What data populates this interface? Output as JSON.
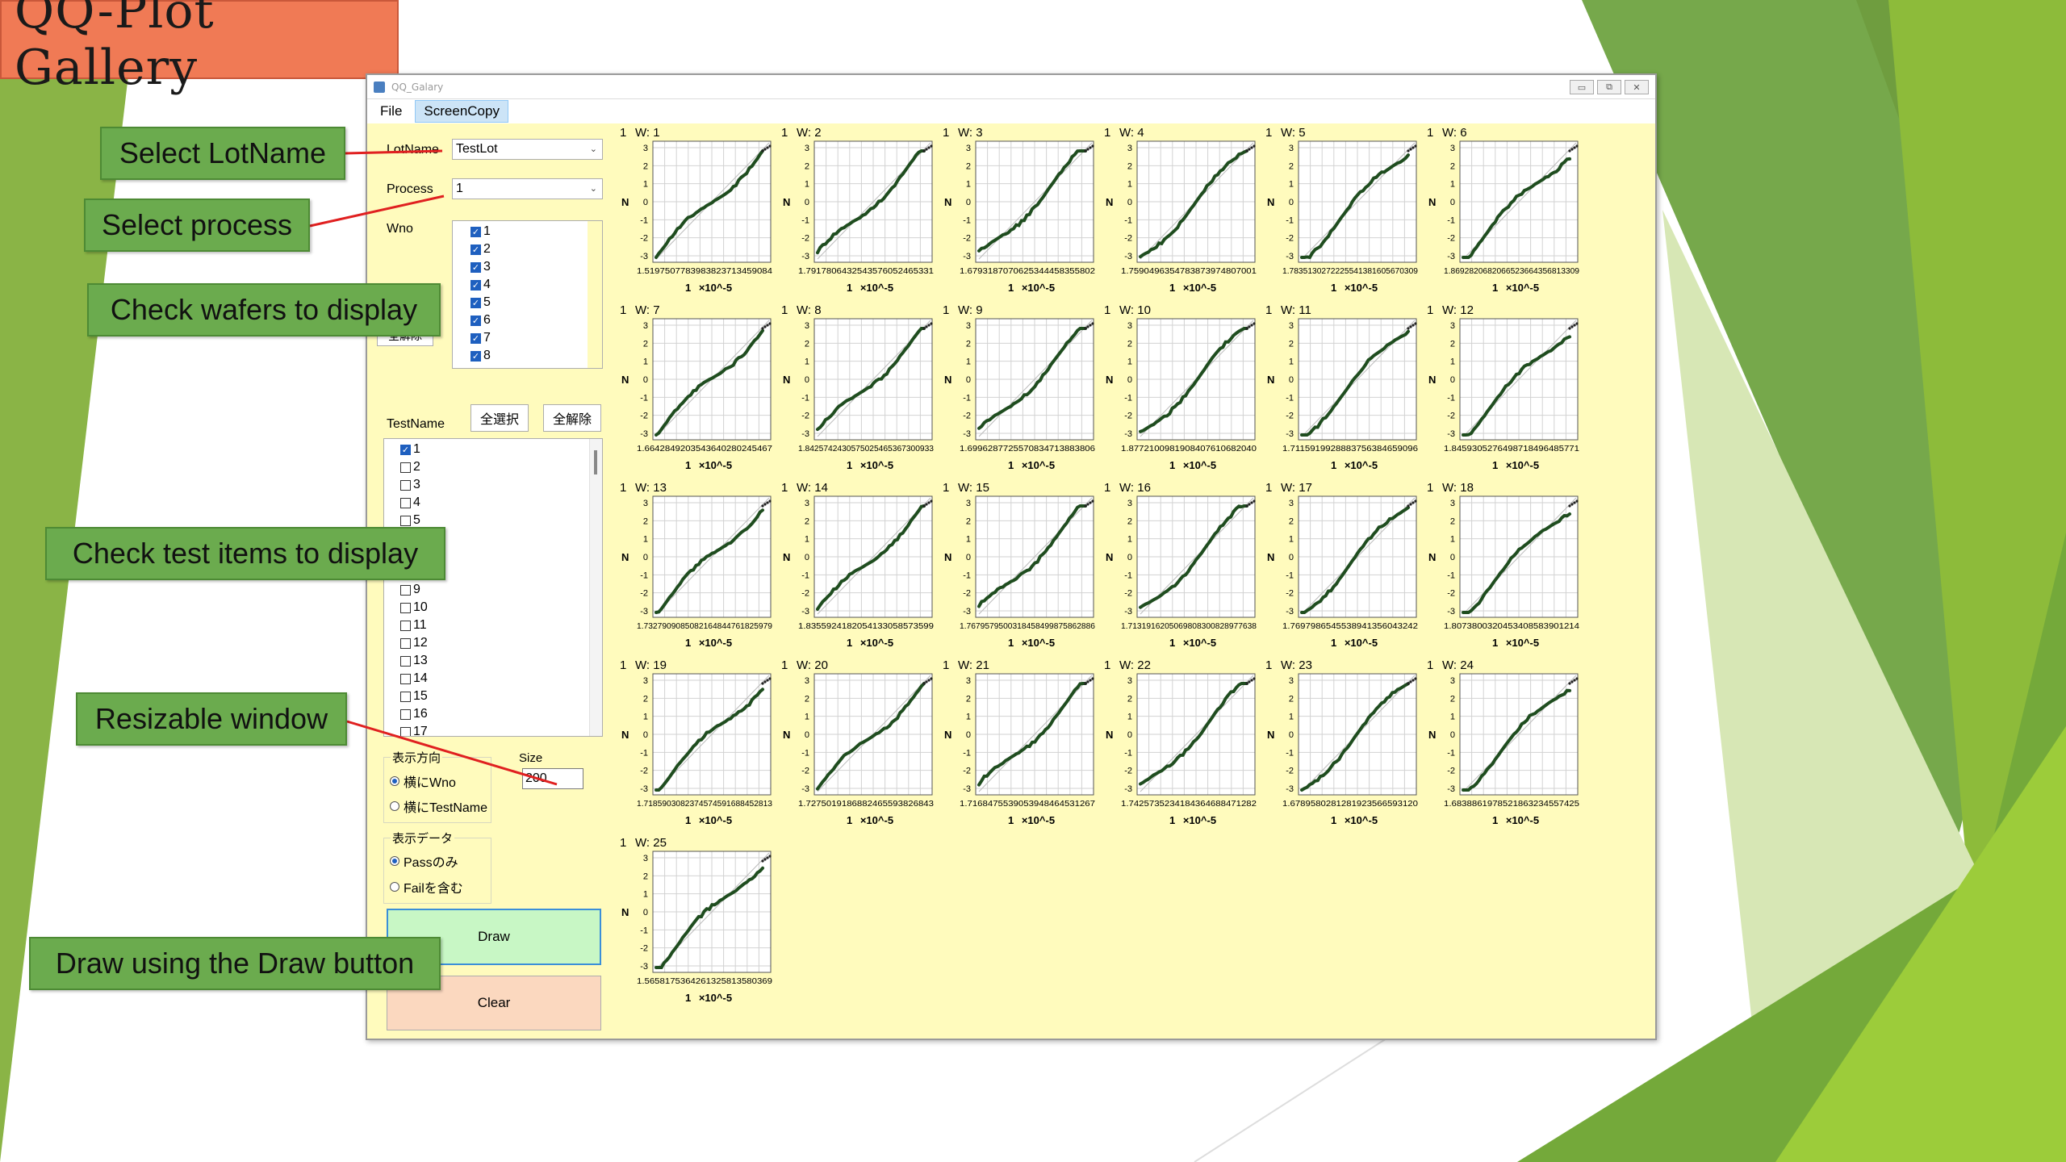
{
  "slide": {
    "title": "QQ-Plot Gallery",
    "callouts": {
      "lotname": "Select LotName",
      "process": "Select process",
      "wafers": "Check wafers to display",
      "tests": "Check test items to display",
      "resize": "Resizable window",
      "draw": "Draw using the Draw button"
    },
    "colors": {
      "title_bg": "#f07a55",
      "callout_bg": "#6bab4e",
      "plot_line": "#1f4d1f",
      "window_bg": "#fffbbd"
    }
  },
  "window": {
    "title": "QQ_Galary",
    "menu": [
      {
        "label": "File"
      },
      {
        "label": "ScreenCopy"
      }
    ],
    "lotname_label": "LotName",
    "lotname_value": "TestLot",
    "process_label": "Process",
    "process_value": "1",
    "wno_label": "Wno",
    "wafers": [
      "1",
      "2",
      "3",
      "4",
      "5",
      "6",
      "7",
      "8"
    ],
    "clear_all_partial": "全解除",
    "testname_label": "TestName",
    "select_all": "全選択",
    "clear_all": "全解除",
    "tests_top": [
      {
        "label": "1",
        "checked": true
      },
      {
        "label": "2",
        "checked": false
      },
      {
        "label": "3",
        "checked": false
      },
      {
        "label": "4",
        "checked": false
      },
      {
        "label": "5",
        "checked": false
      }
    ],
    "tests_bottom": [
      "9",
      "10",
      "11",
      "12",
      "13",
      "14",
      "15",
      "16",
      "17"
    ],
    "direction_group": "表示方向",
    "direction_wno": "横にWno",
    "direction_test": "横にTestName",
    "size_label": "Size",
    "size_value": "200",
    "data_group": "表示データ",
    "data_pass": "Passのみ",
    "data_fail": "Failを含む",
    "draw_button": "Draw",
    "clear_button": "Clear"
  },
  "plots": {
    "y_axis_label": "N",
    "y_ticks": [
      "3",
      "2",
      "1",
      "0",
      "-1",
      "-2",
      "-3"
    ],
    "x_label": "1 ×10^-5",
    "corner_label": "1",
    "items": [
      {
        "title": "W: 1",
        "xticks": "1.5197507783983823713459084"
      },
      {
        "title": "W: 2",
        "xticks": "1.7917806432543576052465331"
      },
      {
        "title": "W: 3",
        "xticks": "1.6793187070625344458355802"
      },
      {
        "title": "W: 4",
        "xticks": "1.7590496354783873974807001"
      },
      {
        "title": "W: 5",
        "xticks": "1.7835130272225541381605670309"
      },
      {
        "title": "W: 6",
        "xticks": "1.8692820682066523664356813309"
      },
      {
        "title": "W: 7",
        "xticks": "1.6642849203543640280245467"
      },
      {
        "title": "W: 8",
        "xticks": "1.8425742430575025465367300933"
      },
      {
        "title": "W: 9",
        "xticks": "1.6996287725570834713883806"
      },
      {
        "title": "W: 10",
        "xticks": "1.8772100981908407610682040"
      },
      {
        "title": "W: 11",
        "xticks": "1.7115919928883756384659096"
      },
      {
        "title": "W: 12",
        "xticks": "1.8459305276498718496485771"
      },
      {
        "title": "W: 13",
        "xticks": "1.7327909085082164844761825979"
      },
      {
        "title": "W: 14",
        "xticks": "1.8355924182054133058573599"
      },
      {
        "title": "W: 15",
        "xticks": "1.7679579500318458499875862886"
      },
      {
        "title": "W: 16",
        "xticks": "1.7131916205069808300828977638"
      },
      {
        "title": "W: 17",
        "xticks": "1.7697986545538941356043242"
      },
      {
        "title": "W: 18",
        "xticks": "1.8073800320453408583901214"
      },
      {
        "title": "W: 19",
        "xticks": "1.7185903082374574591688452813"
      },
      {
        "title": "W: 20",
        "xticks": "1.7275019186882465593826843"
      },
      {
        "title": "W: 21",
        "xticks": "1.7168475539053948464531267"
      },
      {
        "title": "W: 22",
        "xticks": "1.7425735234184364688471282"
      },
      {
        "title": "W: 23",
        "xticks": "1.6789580281281923566593120"
      },
      {
        "title": "W: 24",
        "xticks": "1.6838861978521863234557425"
      },
      {
        "title": "W: 25",
        "xticks": "1.5658175364261325813580369"
      }
    ]
  }
}
